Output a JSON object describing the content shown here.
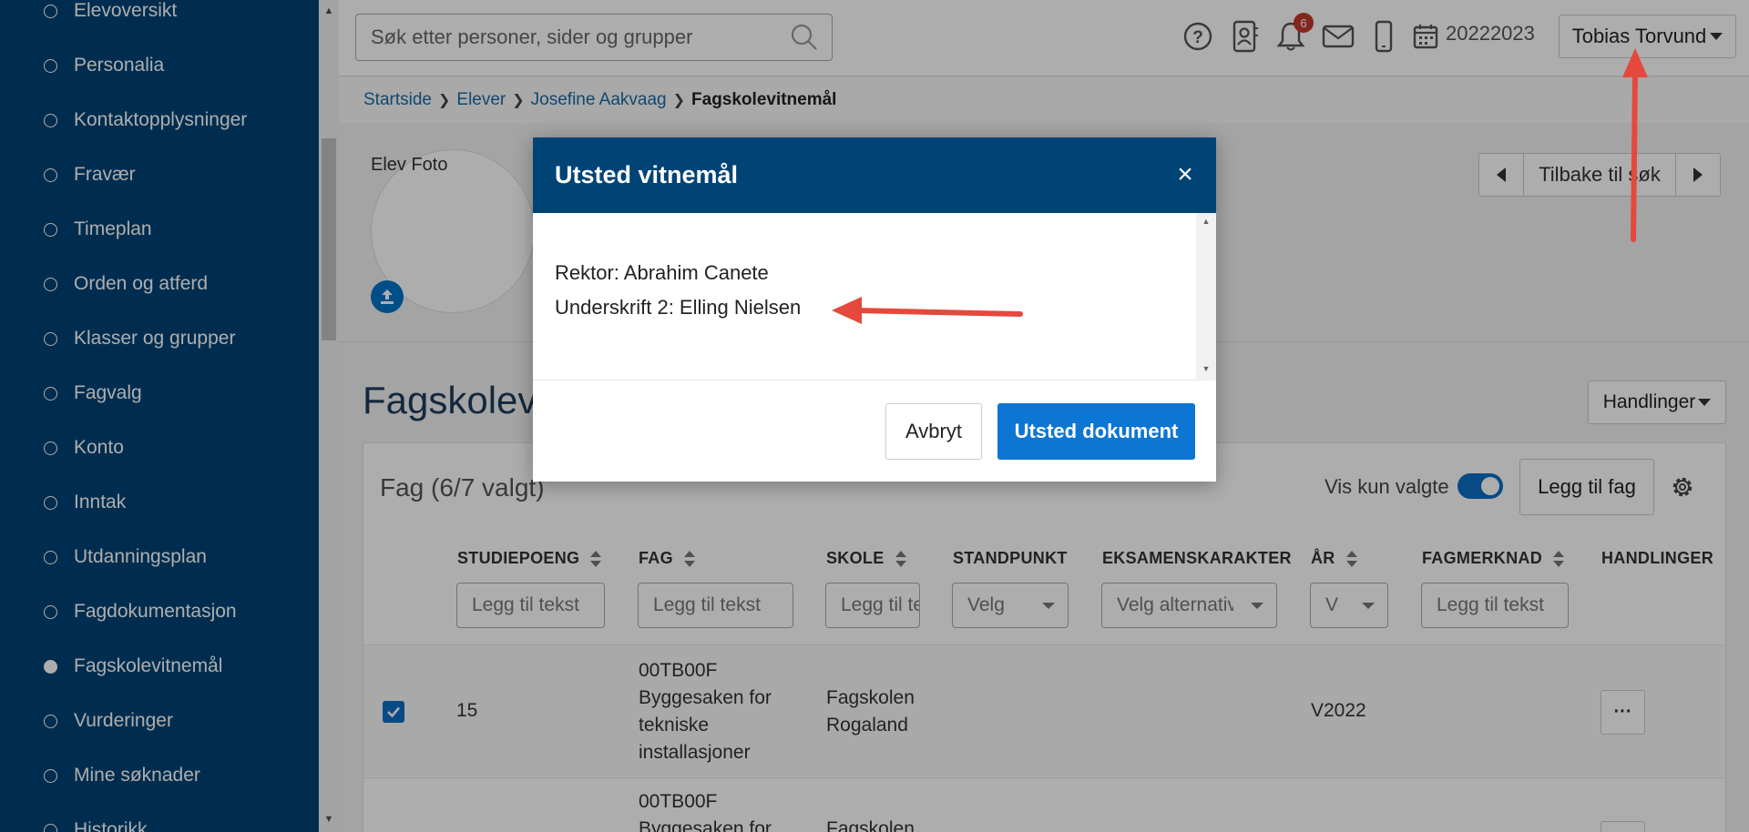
{
  "sidebar": {
    "items": [
      {
        "label": "Elevoversikt",
        "active": false
      },
      {
        "label": "Personalia",
        "active": false
      },
      {
        "label": "Kontaktopplysninger",
        "active": false
      },
      {
        "label": "Fravær",
        "active": false
      },
      {
        "label": "Timeplan",
        "active": false
      },
      {
        "label": "Orden og atferd",
        "active": false
      },
      {
        "label": "Klasser og grupper",
        "active": false
      },
      {
        "label": "Fagvalg",
        "active": false
      },
      {
        "label": "Konto",
        "active": false
      },
      {
        "label": "Inntak",
        "active": false
      },
      {
        "label": "Utdanningsplan",
        "active": false
      },
      {
        "label": "Fagdokumentasjon",
        "active": false
      },
      {
        "label": "Fagskolevitnemål",
        "active": true
      },
      {
        "label": "Vurderinger",
        "active": false
      },
      {
        "label": "Mine søknader",
        "active": false
      },
      {
        "label": "Historikk",
        "active": false
      }
    ]
  },
  "header": {
    "search_placeholder": "Søk etter personer, sider og grupper",
    "notification_count": "6",
    "school_year": "20222023",
    "user_name": "Tobias Torvund"
  },
  "breadcrumb": {
    "items": [
      "Startside",
      "Elever",
      "Josefine Aakvaag"
    ],
    "current": "Fagskolevitnemål"
  },
  "profile": {
    "photo_label": "Elev Foto",
    "nav_back": "Tilbake til søk"
  },
  "main": {
    "title": "Fagskolevitnemål",
    "actions_label": "Handlinger",
    "fag_count": "Fag (6/7 valgt)",
    "vis_kun_valgte": "Vis kun valgte",
    "add_fag": "Legg til fag",
    "columns": [
      "STUDIEPOENG",
      "FAG",
      "SKOLE",
      "STANDPUNKT",
      "EKSAMENSKARAKTER",
      "ÅR",
      "FAGMERKNAD",
      "HANDLINGER"
    ],
    "filters": {
      "text_placeholder": "Legg til tekst",
      "standpunkt": "Velg",
      "eksamen": "Velg alternativ",
      "aar": "V"
    },
    "rows": [
      {
        "studiepoeng": "15",
        "fag_code": "00TB00F",
        "fag_name_1": "Byggesaken for",
        "fag_name_2": "tekniske",
        "fag_name_3": "installasjoner",
        "skole_1": "Fagskolen",
        "skole_2": "Rogaland",
        "aar": "V2022",
        "more": "···"
      },
      {
        "fag_code": "00TB00F",
        "fag_name_1": "Byggesaken for",
        "skole_1": "Fagskolen"
      }
    ]
  },
  "modal": {
    "title": "Utsted vitnemål",
    "close": "×",
    "line1": "Rektor: Abrahim Canete",
    "line2": "Underskrift 2: Elling Nielsen",
    "cancel": "Avbryt",
    "issue": "Utsted dokument"
  },
  "colors": {
    "sidebar_bg": "#004375",
    "primary": "#0d76d2",
    "annotation_arrow": "#e5483c"
  }
}
